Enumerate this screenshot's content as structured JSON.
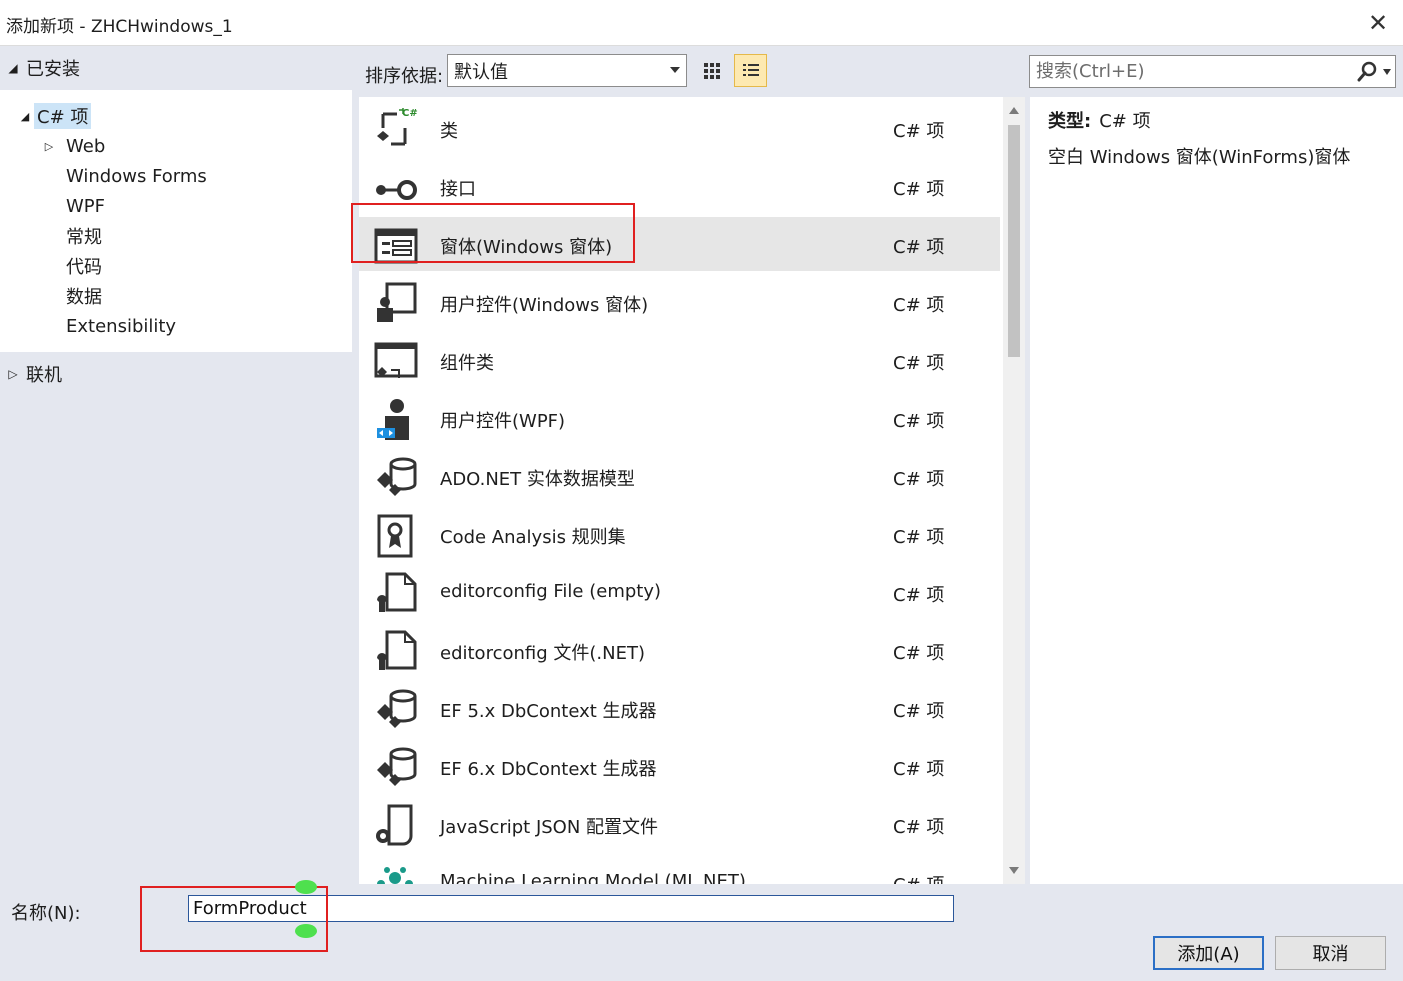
{
  "window": {
    "title": "添加新项 - ZHCHwindows_1",
    "close_glyph": "✕"
  },
  "tree": {
    "installed_label": "已安装",
    "items": [
      {
        "label": "C# 项",
        "expanded": true,
        "selected": true
      },
      {
        "label": "Web",
        "collapsed": true
      },
      {
        "label": "Windows Forms"
      },
      {
        "label": "WPF"
      },
      {
        "label": "常规"
      },
      {
        "label": "代码"
      },
      {
        "label": "数据"
      },
      {
        "label": "Extensibility"
      }
    ],
    "online_label": "联机"
  },
  "toolbar": {
    "sort_label": "排序依据:",
    "sort_value": "默认值",
    "search_placeholder": "搜索(Ctrl+E)"
  },
  "templates": [
    {
      "name": "类",
      "type": "C# 项",
      "icon": "class-icon"
    },
    {
      "name": "接口",
      "type": "C# 项",
      "icon": "interface-icon"
    },
    {
      "name": "窗体(Windows 窗体)",
      "type": "C# 项",
      "icon": "windows-form-icon",
      "selected": true
    },
    {
      "name": "用户控件(Windows 窗体)",
      "type": "C# 项",
      "icon": "user-control-icon"
    },
    {
      "name": "组件类",
      "type": "C# 项",
      "icon": "component-class-icon"
    },
    {
      "name": "用户控件(WPF)",
      "type": "C# 项",
      "icon": "wpf-user-control-icon"
    },
    {
      "name": "ADO.NET 实体数据模型",
      "type": "C# 项",
      "icon": "data-model-icon"
    },
    {
      "name": "Code Analysis 规则集",
      "type": "C# 项",
      "icon": "ruleset-icon"
    },
    {
      "name": "editorconfig File (empty)",
      "type": "C# 项",
      "icon": "config-file-icon"
    },
    {
      "name": "editorconfig 文件(.NET)",
      "type": "C# 项",
      "icon": "config-file-icon"
    },
    {
      "name": "EF 5.x DbContext 生成器",
      "type": "C# 项",
      "icon": "data-model-icon"
    },
    {
      "name": "EF 6.x DbContext 生成器",
      "type": "C# 项",
      "icon": "data-model-icon"
    },
    {
      "name": "JavaScript JSON 配置文件",
      "type": "C# 项",
      "icon": "json-file-icon"
    },
    {
      "name": "Machine Learning Model (ML.NET)",
      "type": "C# 项",
      "icon": "ml-model-icon"
    }
  ],
  "details": {
    "type_label": "类型:",
    "type_value": "C# 项",
    "description": "空白 Windows 窗体(WinForms)窗体"
  },
  "footer": {
    "name_label": "名称(N):",
    "name_value": "FormProduct",
    "add_label": "添加(A)",
    "cancel_label": "取消"
  },
  "colors": {
    "highlight": "#e02020",
    "selection": "#cce4f7",
    "accent": "#2b6fc6"
  }
}
